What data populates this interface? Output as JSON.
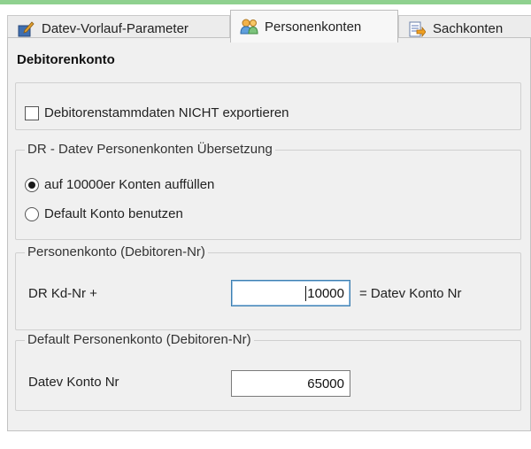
{
  "tabs": [
    {
      "label": "Datev-Vorlauf-Parameter",
      "icon": "blue-pencil-document-icon",
      "active": false
    },
    {
      "label": "Personenkonten",
      "icon": "users-icon",
      "active": true
    },
    {
      "label": "Sachkonten",
      "icon": "document-arrow-icon",
      "active": false
    }
  ],
  "panel": {
    "heading": "Debitorenkonto",
    "export_group": {
      "checkbox_label": "Debitorenstammdaten NICHT exportieren",
      "checked": false
    },
    "translation_group": {
      "legend": "DR - Datev Personenkonten Übersetzung",
      "options": [
        {
          "label": "auf 10000er Konten auffüllen",
          "selected": true
        },
        {
          "label": "Default Konto benutzen",
          "selected": false
        }
      ]
    },
    "account_group": {
      "legend": "Personenkonto (Debitoren-Nr)",
      "field_label": "DR Kd-Nr +",
      "field_value": "10000",
      "suffix_label": "= Datev Konto Nr"
    },
    "default_group": {
      "legend": "Default Personenkonto (Debitoren-Nr)",
      "field_label": "Datev Konto Nr",
      "field_value": "65000"
    }
  }
}
